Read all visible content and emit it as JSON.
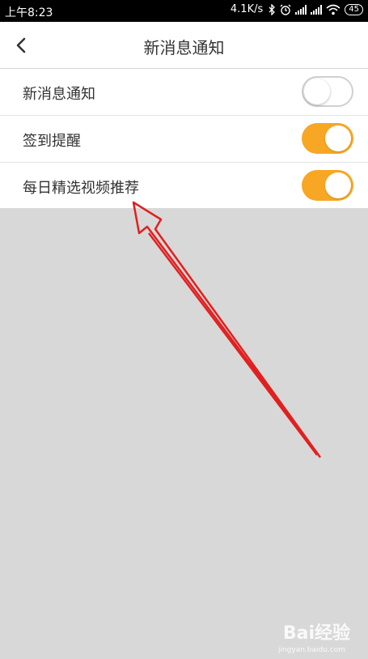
{
  "status_bar": {
    "time": "上午8:23",
    "speed": "4.1K/s",
    "battery": "45"
  },
  "header": {
    "title": "新消息通知"
  },
  "settings": [
    {
      "label": "新消息通知",
      "enabled": false
    },
    {
      "label": "签到提醒",
      "enabled": true
    },
    {
      "label": "每日精选视频推荐",
      "enabled": true
    }
  ],
  "colors": {
    "accent": "#f7a724",
    "arrow": "#e02020",
    "background": "#d8d8d8"
  },
  "watermark": {
    "brand": "Bai经验",
    "url": "jingyan.baidu.com"
  }
}
